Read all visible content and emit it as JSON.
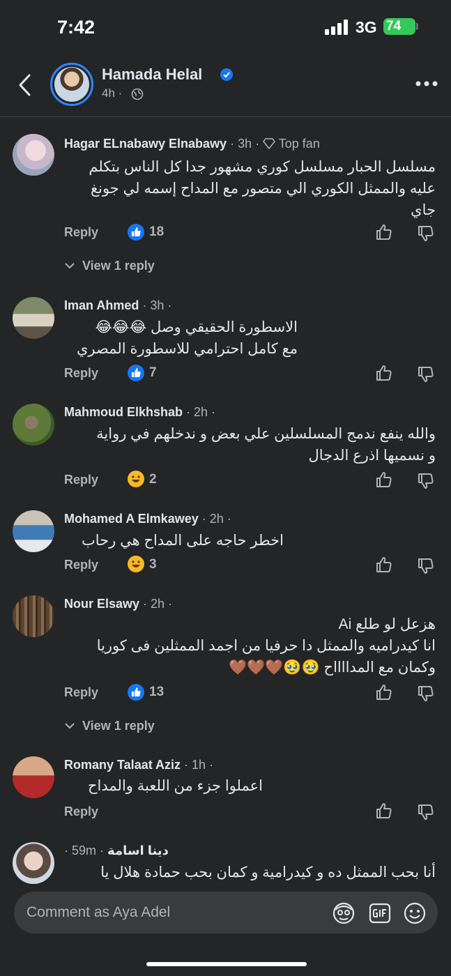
{
  "status": {
    "time": "7:42",
    "network": "3G",
    "battery": "74"
  },
  "post": {
    "author": "Hamada Helal",
    "age": "4h ·"
  },
  "comments": [
    {
      "name": "Hagar ELnabawy Elnabawy",
      "meta": " · 3h · ",
      "badge": "Top fan",
      "lines": [
        "مسلسل الحبار مسلسل كوري مشهور جدا كل الناس بتكلم",
        "عليه والممثل الكوري الي متصور مع المداح إسمه لي جونغ",
        "جاي"
      ],
      "reply_label": "Reply",
      "reaction_count": "18",
      "view_replies": "View 1 reply"
    },
    {
      "name": "Iman Ahmed",
      "meta": " · 3h ·",
      "lines": [
        "الاسطورة الحقيقي وصل 😂😂😂",
        "مع كامل احترامي للاسطورة المصري"
      ],
      "reply_label": "Reply",
      "reaction_count": "7"
    },
    {
      "name": "Mahmoud Elkhshab",
      "meta": " · 2h ·",
      "lines": [
        "والله ينفع ندمج المسلسلين علي بعض و ندخلهم في رواية",
        "و نسميها اذرع الدجال"
      ],
      "reply_label": "Reply",
      "reaction_count": "2"
    },
    {
      "name": "Mohamed A Elmkawey",
      "meta": " · 2h ·",
      "lines": [
        "اخطر حاجه على المداح هي رحاب"
      ],
      "reply_label": "Reply",
      "reaction_count": "3"
    },
    {
      "name": "Nour Elsawy",
      "meta": " · 2h ·",
      "lines": [
        "هزعل لو طلع Ai",
        "انا كيدراميه والممثل دا حرفيا من اجمد الممثلين فى كوريا",
        "وكمان مع المدااااح 🥹🥹🤎🤎🤎"
      ],
      "reply_label": "Reply",
      "reaction_count": "13",
      "view_replies": "View 1 reply"
    },
    {
      "name": "Romany Talaat Aziz",
      "meta": " · 1h ·",
      "lines": [
        "اعملوا جزء من اللعبة والمداح"
      ],
      "reply_label": "Reply"
    },
    {
      "name": "دينا اسامة",
      "meta": "· 59m ·",
      "lines": [
        "أنا بحب الممثل ده و كيدرامية و كمان بحب حمادة هلال يا"
      ]
    }
  ],
  "composer": {
    "placeholder": "Comment as Aya Adel"
  },
  "icons": {
    "reaction_like": "like-reaction-icon",
    "reaction_haha": "haha-reaction-icon",
    "thumbs_up": "thumbs-up-icon",
    "thumbs_down": "thumbs-down-icon"
  },
  "colors": {
    "background": "#242526",
    "accent": "#1877f2",
    "text": "#e4e6eb",
    "secondary": "#b0b3b8"
  }
}
